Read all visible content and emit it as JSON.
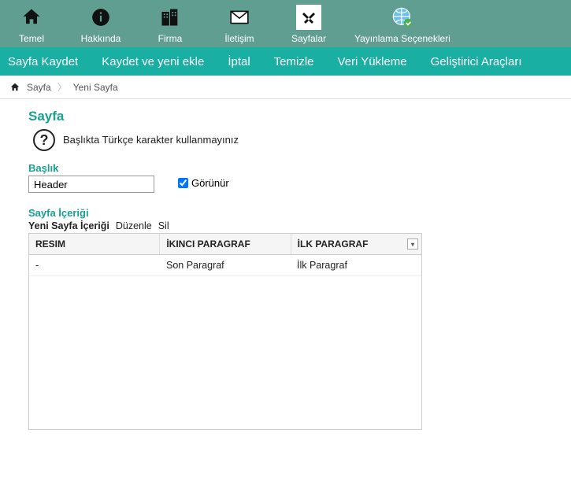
{
  "topnav": {
    "items": [
      {
        "label": "Temel",
        "icon": "home"
      },
      {
        "label": "Hakkında",
        "icon": "info"
      },
      {
        "label": "Firma",
        "icon": "buildings"
      },
      {
        "label": "İletişim",
        "icon": "mail"
      },
      {
        "label": "Sayfalar",
        "icon": "tools",
        "active": true
      },
      {
        "label": "Yayınlama Seçenekleri",
        "icon": "globe"
      }
    ]
  },
  "actionbar": {
    "save": "Sayfa Kaydet",
    "save_new": "Kaydet ve yeni ekle",
    "cancel": "İptal",
    "clear": "Temizle",
    "data_load": "Veri Yükleme",
    "dev_tools": "Geliştirici Araçları"
  },
  "breadcrumb": {
    "root": "Sayfa",
    "current": "Yeni Sayfa"
  },
  "form": {
    "title": "Sayfa",
    "hint": "Başlıkta Türkçe karakter kullanmayınız",
    "header_label": "Başlık",
    "header_value": "Header",
    "visible_label": "Görünür",
    "visible_checked": true,
    "content_label": "Sayfa İçeriği",
    "grid_toolbar": {
      "new": "Yeni Sayfa İçeriği",
      "edit": "Düzenle",
      "delete": "Sil"
    },
    "grid": {
      "columns": [
        "RESIM",
        "İKINCI PARAGRAF",
        "İLK PARAGRAF"
      ],
      "rows": [
        {
          "c0": "-",
          "c1": "Son Paragraf",
          "c2": "İlk Paragraf"
        }
      ]
    }
  }
}
